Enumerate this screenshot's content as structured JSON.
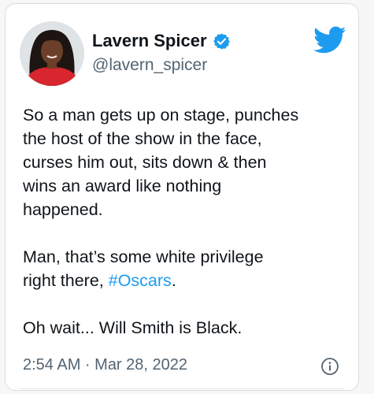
{
  "tweet": {
    "author_name": "Lavern Spicer",
    "author_handle": "@lavern_spicer",
    "verified_icon": "verified-badge-icon",
    "brand_icon": "twitter-bird-icon",
    "paragraph_1": "So a man gets up on stage, punches\nthe host of the show in the face,\ncurses him out, sits down & then\nwins an award like nothing\nhappened.",
    "paragraph_2_prefix": "Man, that’s some white privilege\nright there, ",
    "hashtag": "#Oscars",
    "paragraph_2_suffix": ".",
    "paragraph_3": "Oh wait... Will Smith is Black.",
    "timestamp": "2:54 AM · Mar 28, 2022",
    "info_icon": "info-icon"
  },
  "colors": {
    "accent": "#1d9bf0",
    "text": "#0f1419",
    "secondary_text": "#536471"
  }
}
